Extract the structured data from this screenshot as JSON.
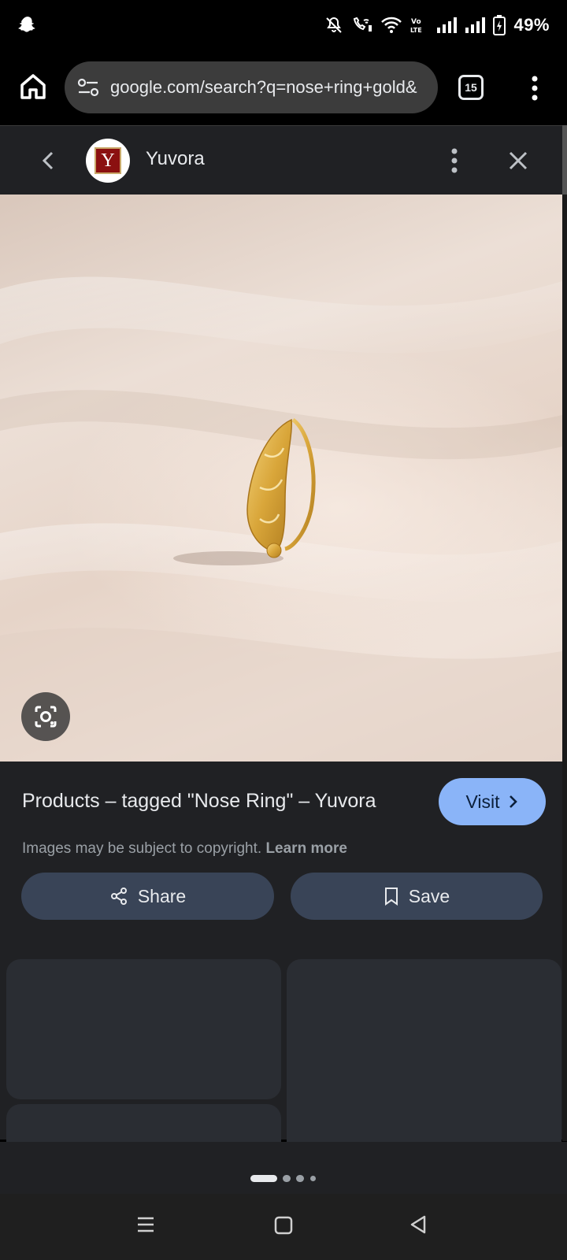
{
  "status_bar": {
    "battery_percent": "49%",
    "icons": [
      "snapchat-icon",
      "mute-icon",
      "wifi-calling-icon",
      "wifi-icon",
      "volte-icon",
      "signal-icon",
      "signal-icon",
      "battery-charging-icon"
    ]
  },
  "browser": {
    "url": "google.com/search?q=nose+ring+gold&",
    "tab_count": "15"
  },
  "panel": {
    "site_name": "Yuvora",
    "logo_letter": "Y"
  },
  "result": {
    "title": "Products – tagged \"Nose Ring\" – Yuvora",
    "visit_label": "Visit",
    "copyright_text": "Images may be subject to copyright.",
    "learn_more_label": "Learn more",
    "share_label": "Share",
    "save_label": "Save"
  },
  "colors": {
    "accent": "#8ab4f8",
    "panel_bg": "#202124",
    "button_bg": "#394457"
  }
}
